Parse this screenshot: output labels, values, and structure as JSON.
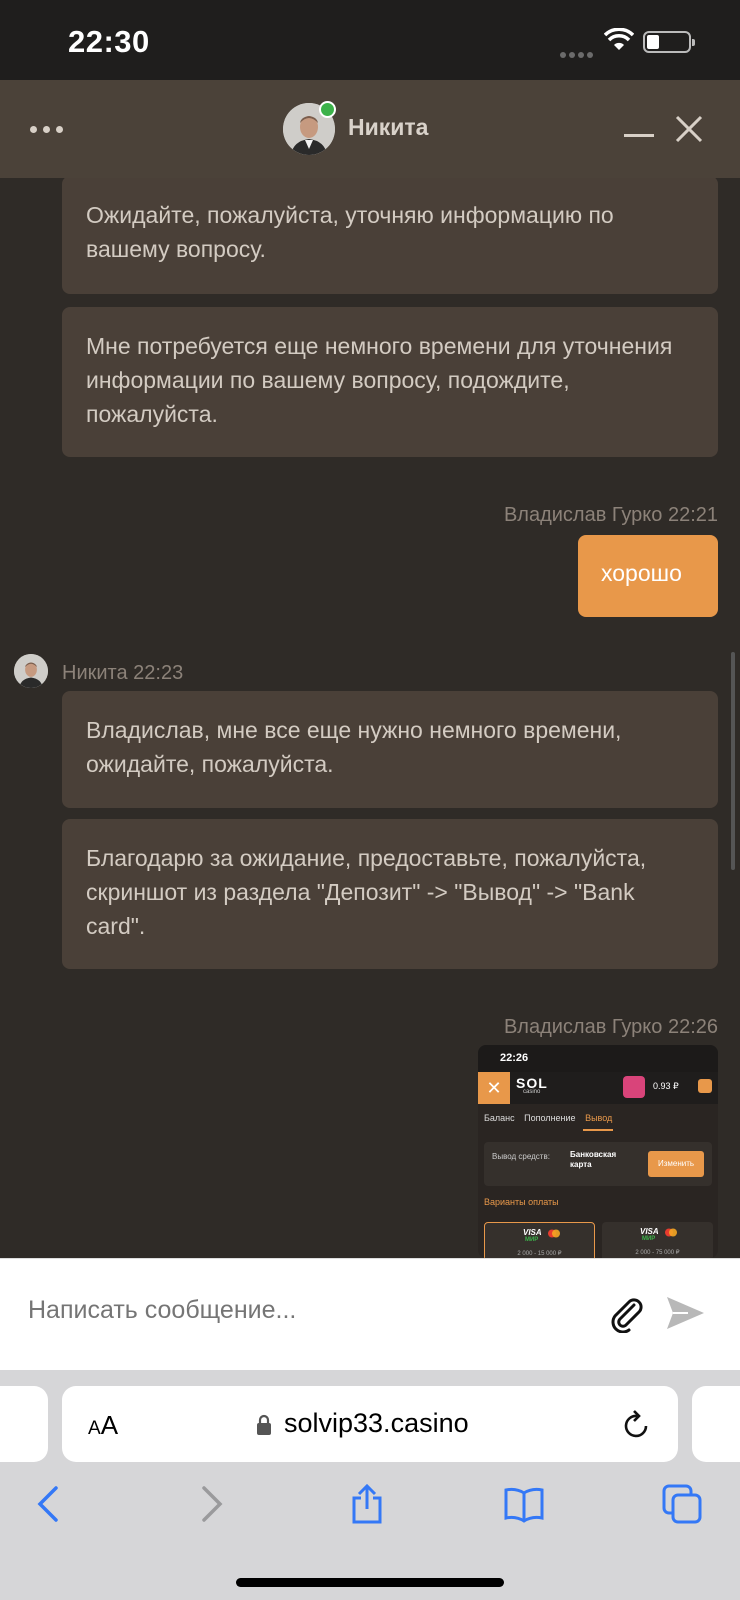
{
  "status_bar": {
    "time": "22:30"
  },
  "chat_header": {
    "agent_name": "Никита"
  },
  "messages": [
    {
      "text": "Ожидайте, пожалуйста, уточняю информацию по вашему вопросу."
    },
    {
      "text": "Мне потребуется еще немного времени для уточнения информации по вашему вопросу, подождите, пожалуйста."
    },
    {
      "sender": "Владислав Гурко 22:21",
      "text": "хорошо"
    },
    {
      "sender": "Никита 22:23",
      "text": "Владислав, мне все еще нужно немного времени, ожидайте, пожалуйста."
    },
    {
      "text": "Благодарю за ожидание, предоставьте, пожалуйста, скриншот из раздела \"Депозит\" -> \"Вывод\" -> \"Bank card\"."
    },
    {
      "sender": "Владислав Гурко 22:26"
    }
  ],
  "attachment": {
    "time": "22:26",
    "logo": "SOL",
    "logo_sub": "casino",
    "balance": "0.93 ₽",
    "tabs": [
      "Баланс",
      "Пополнение",
      "Вывод"
    ],
    "withdraw_label": "Вывод средств:",
    "withdraw_value": "Банковская карта",
    "change_button": "Изменить",
    "variants_title": "Варианты оплаты",
    "cards": [
      {
        "brand": "VISA",
        "sub": "МИР",
        "range": "2 000 - 15 000 ₽"
      },
      {
        "brand": "VISA",
        "sub": "МИР",
        "range": "2 000 - 75 000 ₽"
      }
    ]
  },
  "composer": {
    "placeholder": "Написать сообщение..."
  },
  "browser": {
    "aa_small": "A",
    "aa_large": "A",
    "url": "solvip33.casino"
  },
  "colors": {
    "accent": "#e8984a",
    "bubble": "#4a4038",
    "background": "#2f2b27",
    "header": "#4b4239"
  }
}
